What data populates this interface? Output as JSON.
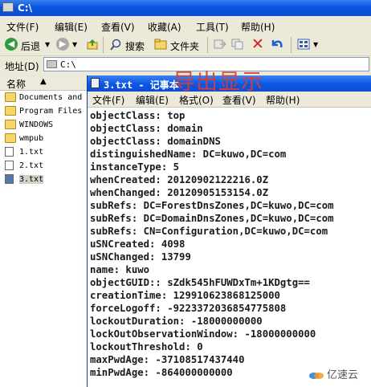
{
  "window": {
    "title": "C:\\"
  },
  "menubar": {
    "items": [
      "文件(F)",
      "编辑(E)",
      "查看(V)",
      "收藏(A)",
      "工具(T)",
      "帮助(H)"
    ]
  },
  "toolbar": {
    "back_label": "后退",
    "search_label": "搜索",
    "folders_label": "文件夹"
  },
  "address": {
    "label": "地址(D)",
    "value": "C:\\"
  },
  "left_pane": {
    "header": "名称",
    "items": [
      {
        "label": "Documents and",
        "type": "folder"
      },
      {
        "label": "Program Files",
        "type": "folder"
      },
      {
        "label": "WINDOWS",
        "type": "folder"
      },
      {
        "label": "wmpub",
        "type": "folder"
      },
      {
        "label": "1.txt",
        "type": "file"
      },
      {
        "label": "2.txt",
        "type": "file"
      },
      {
        "label": "3.txt",
        "type": "file",
        "selected": true
      }
    ]
  },
  "notepad": {
    "title": "3.txt - 记事本",
    "menu": [
      "文件(F)",
      "编辑(E)",
      "格式(O)",
      "查看(V)",
      "帮助(H)"
    ],
    "lines": [
      "objectClass: top",
      "objectClass: domain",
      "objectClass: domainDNS",
      "distinguishedName: DC=kuwo,DC=com",
      "instanceType: 5",
      "whenCreated: 20120902122216.0Z",
      "whenChanged: 20120905153154.0Z",
      "subRefs: DC=ForestDnsZones,DC=kuwo,DC=com",
      "subRefs: DC=DomainDnsZones,DC=kuwo,DC=com",
      "subRefs: CN=Configuration,DC=kuwo,DC=com",
      "uSNCreated: 4098",
      "uSNChanged: 13799",
      "name: kuwo",
      "objectGUID:: sZdk545hFUWDxTm+1KDgtg==",
      "creationTime: 129910623868125000",
      "forceLogoff: -9223372036854775808",
      "lockoutDuration: -18000000000",
      "lockOutObservationWindow: -18000000000",
      "lockoutThreshold: 0",
      "maxPwdAge: -37108517437440",
      "minPwdAge: -864000000000"
    ]
  },
  "overlay_text": "导出显示",
  "watermark": "亿速云",
  "colors": {
    "titlebar_blue": "#0b55e0",
    "overlay_red": "#e23a2a"
  }
}
